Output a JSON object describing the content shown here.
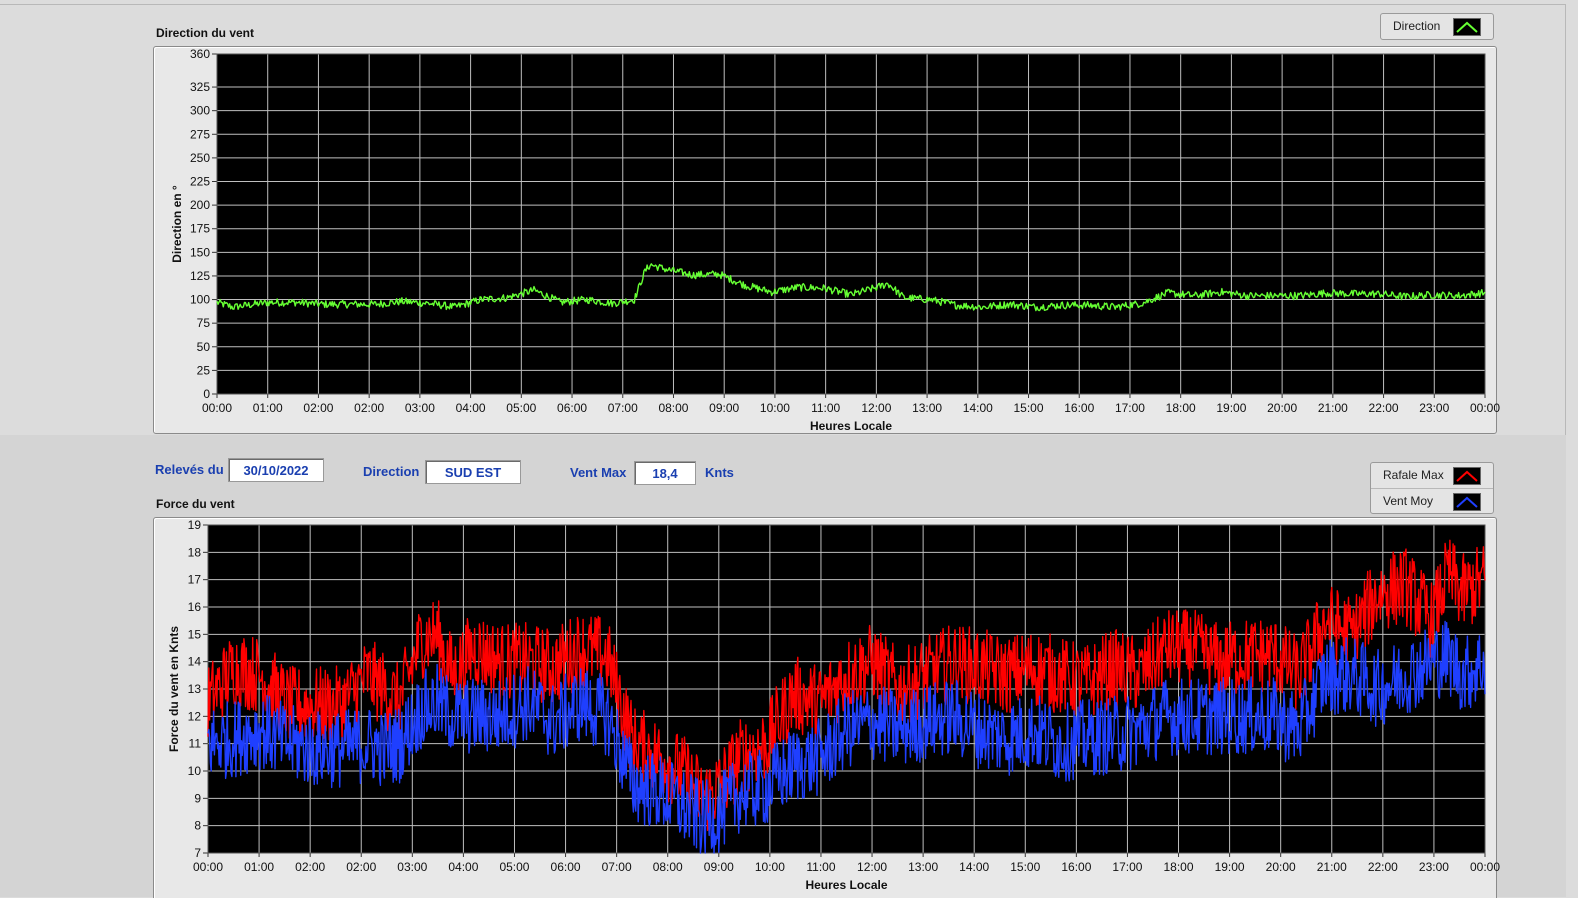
{
  "controls": {
    "releves_label": "Relevés du",
    "releves_value": "30/10/2022",
    "direction_label": "Direction",
    "direction_value": "SUD EST",
    "ventmax_label": "Vent Max",
    "ventmax_value": "18,4",
    "ventmax_unit": "Knts"
  },
  "chart_data": [
    {
      "type": "line",
      "title": "Direction du vent",
      "xlabel": "Heures Locale",
      "ylabel": "Direction en °",
      "xlim": [
        0,
        24
      ],
      "ylim": [
        0,
        360
      ],
      "yticks": [
        0,
        25,
        50,
        75,
        100,
        125,
        150,
        175,
        200,
        225,
        250,
        275,
        300,
        325,
        360
      ],
      "xtick_labels": [
        "00:00",
        "01:00",
        "02:00",
        "02:00",
        "03:00",
        "04:00",
        "05:00",
        "06:00",
        "07:00",
        "08:00",
        "09:00",
        "10:00",
        "11:00",
        "12:00",
        "13:00",
        "14:00",
        "15:00",
        "16:00",
        "17:00",
        "18:00",
        "19:00",
        "20:00",
        "21:00",
        "22:00",
        "23:00",
        "00:00"
      ],
      "grid": true,
      "legend": "top-right",
      "series": [
        {
          "name": "Direction",
          "color": "#66ff33",
          "x": [
            0,
            0.3,
            0.7,
            1,
            1.5,
            2,
            2.5,
            3,
            3.5,
            4,
            4.5,
            5,
            5.5,
            6,
            6.5,
            7,
            7.5,
            7.9,
            8.1,
            8.2,
            8.5,
            9,
            9.5,
            10,
            10.5,
            11,
            11.5,
            12,
            12.5,
            12.7,
            13,
            13.5,
            14,
            14.5,
            15,
            15.5,
            16,
            16.5,
            17,
            17.5,
            18,
            18.5,
            19,
            19.5,
            20,
            20.5,
            21,
            21.5,
            22,
            22.5,
            23,
            23.5,
            24
          ],
          "y": [
            97,
            92,
            95,
            97,
            97,
            95,
            95,
            95,
            98,
            96,
            92,
            100,
            102,
            110,
            97,
            100,
            96,
            100,
            130,
            137,
            132,
            126,
            127,
            115,
            108,
            113,
            112,
            105,
            113,
            117,
            102,
            100,
            94,
            92,
            95,
            92,
            94,
            94,
            92,
            96,
            107,
            104,
            108,
            104,
            104,
            104,
            107,
            106,
            106,
            103,
            105,
            104,
            107
          ]
        }
      ]
    },
    {
      "type": "line",
      "title": "Force du vent",
      "xlabel": "Heures Locale",
      "ylabel": "Force du vent en Knts",
      "xlim": [
        0,
        24
      ],
      "ylim": [
        7,
        19
      ],
      "yticks": [
        7,
        8,
        9,
        10,
        11,
        12,
        13,
        14,
        15,
        16,
        17,
        18,
        19
      ],
      "xtick_labels": [
        "00:00",
        "01:00",
        "02:00",
        "02:00",
        "03:00",
        "04:00",
        "05:00",
        "06:00",
        "07:00",
        "08:00",
        "09:00",
        "10:00",
        "11:00",
        "12:00",
        "13:00",
        "14:00",
        "15:00",
        "16:00",
        "17:00",
        "18:00",
        "19:00",
        "20:00",
        "21:00",
        "22:00",
        "23:00",
        "00:00"
      ],
      "grid": true,
      "legend": "top-right",
      "series": [
        {
          "name": "Rafale Max",
          "color": "#ff0000",
          "x": [
            0,
            0.5,
            1,
            1.5,
            2,
            2.5,
            3,
            3.3,
            3.6,
            4,
            4.3,
            4.6,
            5,
            5.5,
            6,
            6.5,
            7,
            7.5,
            8,
            8.5,
            9,
            9.3,
            9.6,
            10,
            10.5,
            11,
            11.5,
            12,
            12.5,
            13,
            13.5,
            14,
            14.5,
            15,
            15.5,
            16,
            16.5,
            17,
            17.5,
            18,
            18.5,
            19,
            19.5,
            20,
            20.5,
            21,
            21.5,
            22,
            22.5,
            23,
            23.3,
            23.6,
            24
          ],
          "y": [
            12.5,
            13.8,
            13.5,
            12.4,
            12.4,
            12.4,
            13.5,
            13,
            12.5,
            14.8,
            15,
            13.5,
            14.5,
            14,
            14,
            13.8,
            14.5,
            14.2,
            11,
            10.5,
            9.8,
            9,
            9.4,
            10.5,
            11,
            12.8,
            12.5,
            13.5,
            14,
            13,
            13.5,
            14,
            13.8,
            13.5,
            13.8,
            13.5,
            13.2,
            13.8,
            13.5,
            14.5,
            14.5,
            14,
            14.2,
            14.3,
            13.5,
            15.5,
            15,
            16.5,
            16.8,
            15.5,
            17.2,
            16.5,
            17
          ]
        },
        {
          "name": "Vent Moy",
          "color": "#1f3fff",
          "x": [
            0,
            0.5,
            1,
            1.5,
            2,
            2.5,
            3,
            3.3,
            3.6,
            4,
            4.3,
            4.6,
            5,
            5.5,
            6,
            6.5,
            7,
            7.5,
            8,
            8.5,
            9,
            9.3,
            9.6,
            10,
            10.5,
            11,
            11.5,
            12,
            12.5,
            13,
            13.5,
            14,
            14.5,
            15,
            15.5,
            16,
            16.5,
            17,
            17.5,
            18,
            18.5,
            19,
            19.5,
            20,
            20.5,
            21,
            21.5,
            22,
            22.5,
            23,
            23.3,
            23.6,
            24
          ],
          "y": [
            11,
            11.2,
            11.5,
            11,
            10.8,
            10.8,
            11,
            10.8,
            11,
            12.2,
            12.5,
            12,
            12,
            12,
            12.5,
            11.8,
            12.5,
            12,
            9.5,
            9.2,
            8.6,
            8.2,
            8.4,
            9.2,
            9.4,
            10.2,
            10.5,
            11.5,
            11.8,
            11.5,
            11.8,
            12,
            11.5,
            11.2,
            11.5,
            11,
            11.2,
            11.3,
            11.5,
            12,
            12,
            12,
            12,
            12,
            11.5,
            13.5,
            13.5,
            13,
            13.5,
            14,
            14.2,
            13.5,
            14
          ]
        }
      ]
    }
  ]
}
